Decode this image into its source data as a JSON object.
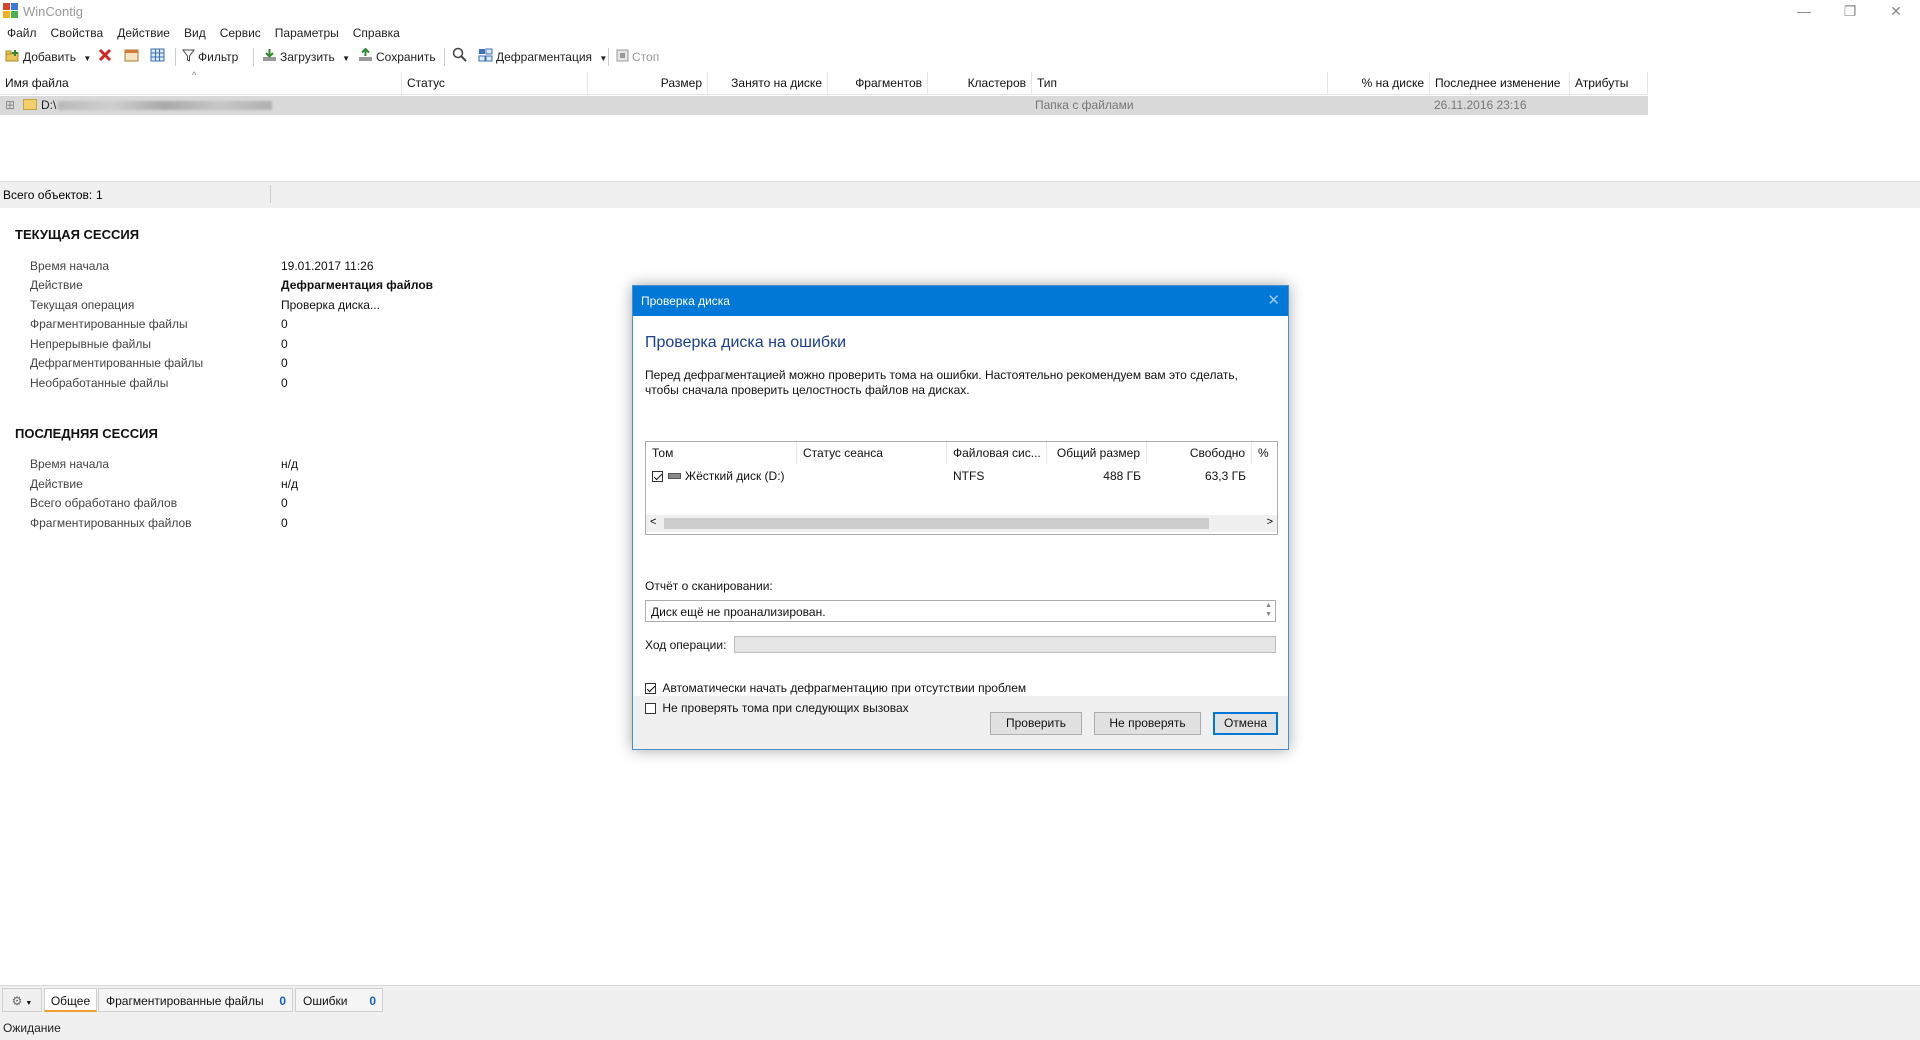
{
  "window": {
    "title": "WinContig",
    "controls": {
      "minimize": "—",
      "restore": "❐",
      "close": "✕"
    }
  },
  "menu": [
    "Файл",
    "Свойства",
    "Действие",
    "Вид",
    "Сервис",
    "Параметры",
    "Справка"
  ],
  "toolbar": {
    "add": "Добавить",
    "filter": "Фильтр",
    "load": "Загрузить",
    "save": "Сохранить",
    "defrag": "Дефрагментация",
    "stop": "Стоп"
  },
  "file_list": {
    "columns": [
      "Имя файла",
      "Статус",
      "Размер",
      "Занято на диске",
      "Фрагментов",
      "Кластеров",
      "Тип",
      "% на диске",
      "Последнее изменение",
      "Атрибуты"
    ],
    "rows": [
      {
        "name": "D:\\",
        "type": "Папка с файлами",
        "modified": "26.11.2016 23:16"
      }
    ],
    "total_label": "Всего объектов:",
    "total_value": "1"
  },
  "current_session": {
    "title": "ТЕКУЩАЯ СЕССИЯ",
    "rows": [
      {
        "label": "Время начала",
        "value": "19.01.2017 11:26"
      },
      {
        "label": "Действие",
        "value": "Дефрагментация файлов"
      },
      {
        "label": "Текущая операция",
        "value": "Проверка диска..."
      },
      {
        "label": "Фрагментированные файлы",
        "value": "0"
      },
      {
        "label": "Непрерывные файлы",
        "value": "0"
      },
      {
        "label": "Дефрагментированные файлы",
        "value": "0"
      },
      {
        "label": "Необработанные файлы",
        "value": "0"
      }
    ]
  },
  "last_session": {
    "title": "ПОСЛЕДНЯЯ СЕССИЯ",
    "rows": [
      {
        "label": "Время начала",
        "value": "н/д"
      },
      {
        "label": "Действие",
        "value": "н/д"
      },
      {
        "label": "Всего обработано файлов",
        "value": "0"
      },
      {
        "label": "Фрагментированных файлов",
        "value": "0"
      }
    ]
  },
  "dialog": {
    "title": "Проверка диска",
    "heading": "Проверка диска на ошибки",
    "description": "Перед дефрагментацией можно проверить тома на ошибки. Настоятельно рекомендуем вам это сделать, чтобы сначала проверить целостность файлов на дисках.",
    "table": {
      "columns": [
        "Том",
        "Статус сеанса",
        "Файловая сис...",
        "Общий размер",
        "Свободно",
        "%"
      ],
      "rows": [
        {
          "checked": true,
          "volume": "Жёсткий диск (D:)",
          "status": "",
          "fs": "NTFS",
          "total": "488 ГБ",
          "free": "63,3 ГБ"
        }
      ]
    },
    "report_label": "Отчёт о сканировании:",
    "report_text": "Диск ещё не проанализирован.",
    "progress_label": "Ход операции:",
    "progress": 0,
    "options": [
      {
        "label": "Автоматически начать дефрагментацию при отсутствии проблем",
        "checked": true
      },
      {
        "label": "Не проверять тома при следующих вызовах",
        "checked": false
      }
    ],
    "buttons": {
      "check": "Проверить",
      "skip": "Не проверять",
      "cancel": "Отмена"
    }
  },
  "bottom_tabs": [
    {
      "label": "Общее"
    },
    {
      "label": "Фрагментированные файлы",
      "count": "0"
    },
    {
      "label": "Ошибки",
      "count": "0"
    }
  ],
  "status": "Ожидание"
}
